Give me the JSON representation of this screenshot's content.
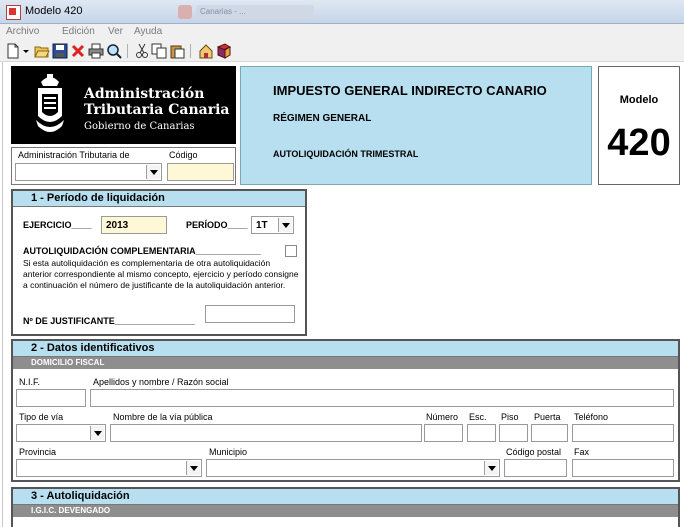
{
  "window": {
    "title": "Modelo 420",
    "background_tab": "Canarias - ..."
  },
  "menu": [
    "Archivo",
    "Edición",
    "Ver",
    "Ayuda"
  ],
  "toolbar_icons": [
    "new-document-icon",
    "dropdown-arrow-icon",
    "open-folder-icon",
    "save-icon",
    "delete-icon",
    "print-icon",
    "print-preview-icon",
    "cut-icon",
    "copy-icon",
    "paste-icon",
    "home-icon",
    "book-icon"
  ],
  "logo": {
    "line1": "Administración",
    "line2": "Tributaria Canaria",
    "line3": "Gobierno de Canarias"
  },
  "header": {
    "title": "IMPUESTO GENERAL INDIRECTO CANARIO",
    "regime": "RÉGIMEN GENERAL",
    "type": "AUTOLIQUIDACIÓN TRIMESTRAL"
  },
  "modelo": {
    "label": "Modelo",
    "number": "420"
  },
  "admin": {
    "label": "Administración Tributaria de",
    "codigo_label": "Código",
    "value": "",
    "codigo": ""
  },
  "periodo": {
    "heading": "1 - Período de liquidación",
    "ejercicio_label": "EJERCICIO____",
    "ejercicio": "2013",
    "periodo_label": "PERÍODO____",
    "periodo": "1T",
    "complementaria_label": "AUTOLIQUIDACIÓN COMPLEMENTARIA_____________",
    "complementaria_text": "Si esta autoliquidación es complementaria de otra autoliquidación anterior correspondiente al mismo concepto, ejercicio y período consigne a continuación el número de justificante de la autoliquidación anterior.",
    "justificante_label": "Nº DE JUSTIFICANTE________________",
    "justificante": ""
  },
  "datos": {
    "heading": "2 - Datos identificativos",
    "subheading": "DOMICILIO FISCAL",
    "nif_label": "N.I.F.",
    "nombre_label": "Apellidos y nombre / Razón social",
    "tipo_via_label": "Tipo de vía",
    "nombre_via_label": "Nombre de la vía pública",
    "numero_label": "Número",
    "esc_label": "Esc.",
    "piso_label": "Piso",
    "puerta_label": "Puerta",
    "telefono_label": "Teléfono",
    "provincia_label": "Provincia",
    "municipio_label": "Municipio",
    "cp_label": "Código postal",
    "fax_label": "Fax"
  },
  "autoliquidacion": {
    "heading": "3 - Autoliquidación",
    "subheading": "I.G.I.C. DEVENGADO"
  }
}
